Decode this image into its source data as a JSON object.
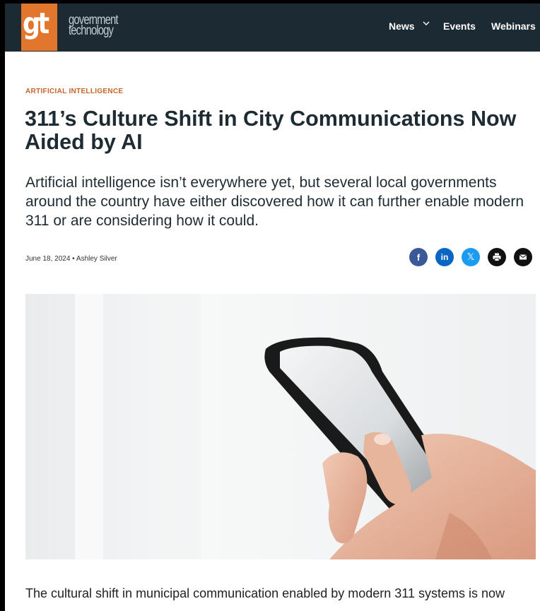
{
  "brand": {
    "logo_mark": "gt",
    "logo_line1": "government",
    "logo_line2": "technology",
    "accent_color": "#e2762c",
    "header_color": "#1b2a33"
  },
  "nav": {
    "items": [
      {
        "label": "News",
        "has_dropdown": true
      },
      {
        "label": "Events",
        "has_dropdown": false
      },
      {
        "label": "Webinars",
        "has_dropdown": false
      }
    ]
  },
  "article": {
    "category": "ARTIFICIAL INTELLIGENCE",
    "title": "311’s Culture Shift in City Communications Now Aided by AI",
    "subtitle": "Artificial intelligence isn’t everywhere yet, but several local governments around the country have either discovered how it can further enable modern 311 or are considering how it could.",
    "date": "June 18, 2024",
    "separator": "•",
    "author": "Ashley Silver",
    "body_first_line": "The cultural shift in municipal communication enabled by modern 311 systems is now"
  },
  "share": [
    {
      "icon": "facebook-icon",
      "glyph": "f",
      "color": "#3b5998"
    },
    {
      "icon": "linkedin-icon",
      "glyph": "in",
      "color": "#0a66c2"
    },
    {
      "icon": "x-twitter-icon",
      "glyph": "𝕏",
      "color": "#1d9bf0"
    },
    {
      "icon": "print-icon",
      "glyph": "",
      "color": "#111111"
    },
    {
      "icon": "email-icon",
      "glyph": "",
      "color": "#111111"
    }
  ]
}
